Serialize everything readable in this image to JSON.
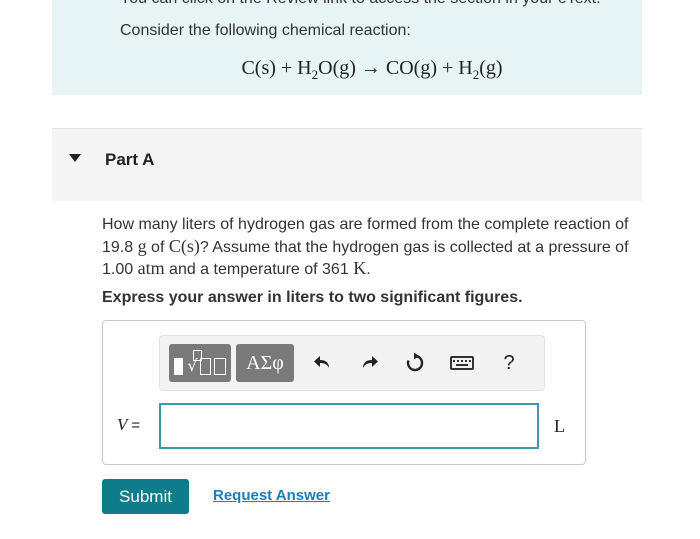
{
  "intro": {
    "cutoff_text": "You can click on the Review link to access the section in your eText.",
    "lead": "Consider the following chemical reaction:",
    "equation": {
      "r1": "C(s)",
      "plus1": "+",
      "r2_pre": "H",
      "r2_sub": "2",
      "r2_post": "O(g)",
      "arrow": "→",
      "p1": "CO(g)",
      "plus2": "+",
      "p2_pre": "H",
      "p2_sub": "2",
      "p2_post": "(g)"
    }
  },
  "part": {
    "title": "Part A"
  },
  "question": {
    "t1": "How many liters of hydrogen gas are formed from the complete reaction of ",
    "mass": "19.8",
    "mass_unit": "g",
    "t2": " of ",
    "species": "C(s)",
    "t3": "? Assume that the hydrogen gas is collected at a pressure of ",
    "pressure": "1.00",
    "pressure_unit": "atm",
    "t4": " and a temperature of ",
    "temperature": "361",
    "temperature_unit": "K",
    "t5": "."
  },
  "instruction": "Express your answer in liters to two significant figures.",
  "toolbar": {
    "greek_label": "ΑΣφ",
    "help_label": "?",
    "icons": [
      "templates-icon",
      "undo-icon",
      "redo-icon",
      "reset-icon",
      "keyboard-icon",
      "help-icon"
    ]
  },
  "answer": {
    "variable": "V",
    "equals": "=",
    "value": "",
    "unit": "L"
  },
  "actions": {
    "submit_label": "Submit",
    "request_label": "Request Answer"
  },
  "colors": {
    "intro_bg": "#e7f4f5",
    "submit_bg": "#0e7c8a",
    "input_border": "#3b9aa8",
    "link": "#1a7fb8"
  }
}
